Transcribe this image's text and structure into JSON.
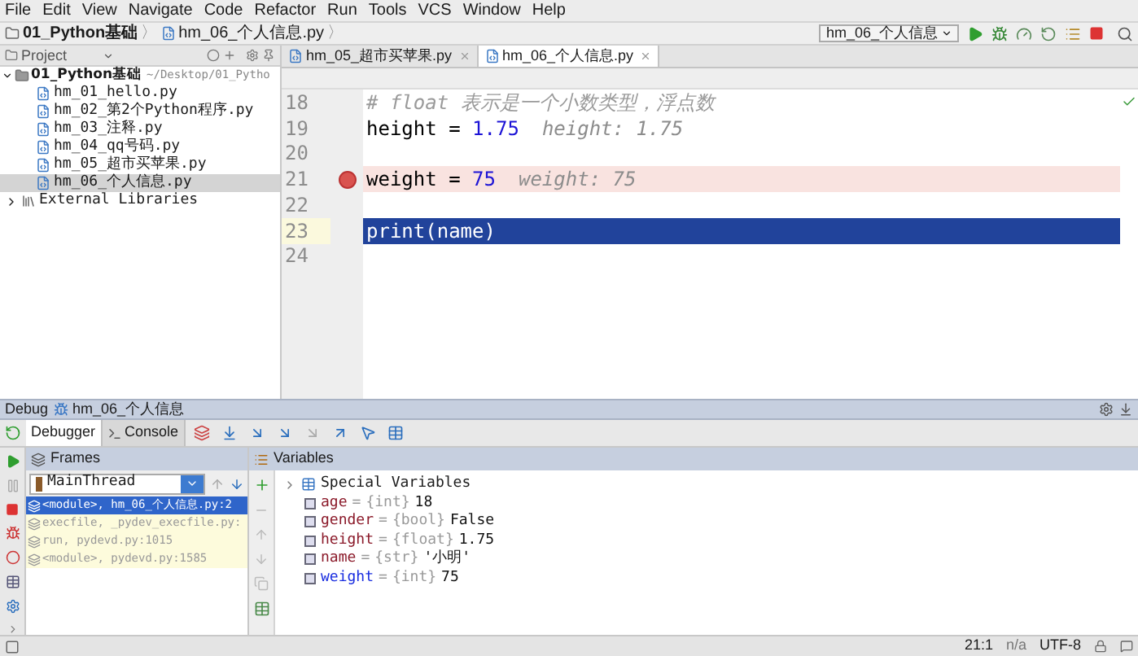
{
  "menu": [
    "File",
    "Edit",
    "View",
    "Navigate",
    "Code",
    "Refactor",
    "Run",
    "Tools",
    "VCS",
    "Window",
    "Help"
  ],
  "breadcrumb": {
    "project": "01_Python基础",
    "file": "hm_06_个人信息.py",
    "separator": "〉"
  },
  "run_config": "hm_06_个人信息",
  "project_panel": {
    "title": "Project",
    "root": {
      "label": "01_Python基础",
      "path": "~/Desktop/01_Pytho",
      "expanded": true,
      "children": [
        {
          "label": "hm_01_hello.py",
          "selected": false
        },
        {
          "label": "hm_02_第2个Python程序.py",
          "selected": false
        },
        {
          "label": "hm_03_注释.py",
          "selected": false
        },
        {
          "label": "hm_04_qq号码.py",
          "selected": false
        },
        {
          "label": "hm_05_超市买苹果.py",
          "selected": false
        },
        {
          "label": "hm_06_个人信息.py",
          "selected": true
        }
      ]
    },
    "libraries": {
      "label": "External Libraries",
      "expanded": false
    }
  },
  "editor_tabs": [
    {
      "label": "hm_05_超市买苹果.py",
      "selected": false
    },
    {
      "label": "hm_06_个人信息.py",
      "selected": true
    }
  ],
  "code_lines": [
    {
      "number": "18",
      "breakpoint": false,
      "current": false,
      "segments": [
        {
          "kind": "comment",
          "text": "# float 表示是一个小数类型，浮点数"
        }
      ]
    },
    {
      "number": "19",
      "breakpoint": false,
      "current": false,
      "segments": [
        {
          "kind": "plain",
          "text": "height = "
        },
        {
          "kind": "number",
          "text": "1.75"
        },
        {
          "kind": "hint",
          "text": "height: 1.75"
        }
      ]
    },
    {
      "number": "20",
      "breakpoint": false,
      "current": false
    },
    {
      "number": "21",
      "breakpoint": true,
      "current": false,
      "segments": [
        {
          "kind": "plain",
          "text": "weight = "
        },
        {
          "kind": "number",
          "text": "75"
        },
        {
          "kind": "hint",
          "text": "weight: 75"
        }
      ]
    },
    {
      "number": "22",
      "breakpoint": false,
      "current": false
    },
    {
      "number": "23",
      "breakpoint": false,
      "current": true,
      "segments": [
        {
          "kind": "plain",
          "text": "print(name)"
        }
      ]
    },
    {
      "number": "24",
      "breakpoint": false,
      "current": false
    }
  ],
  "debug": {
    "title": "Debug",
    "config": "hm_06_个人信息",
    "tabs": [
      {
        "label": "Debugger",
        "selected": true
      },
      {
        "label": "Console",
        "selected": false
      }
    ],
    "frames": {
      "title": "Frames",
      "thread": "MainThread",
      "items": [
        {
          "label": "<module>, hm_06_个人信息.py:2",
          "selected": true,
          "library": false
        },
        {
          "label": "execfile, _pydev_execfile.py:",
          "selected": false,
          "library": true
        },
        {
          "label": "run, pydevd.py:1015",
          "selected": false,
          "library": true
        },
        {
          "label": "<module>, pydevd.py:1585",
          "selected": false,
          "library": true
        }
      ]
    },
    "variables": {
      "title": "Variables",
      "special": {
        "label": "Special Variables",
        "expanded": false
      },
      "items": [
        {
          "name": "age",
          "sign": "=",
          "type": "{int}",
          "value": "18",
          "changed": false
        },
        {
          "name": "gender",
          "sign": "=",
          "type": "{bool}",
          "value": "False",
          "changed": false
        },
        {
          "name": "height",
          "sign": "=",
          "type": "{float}",
          "value": "1.75",
          "changed": false
        },
        {
          "name": "name",
          "sign": "=",
          "type": "{str}",
          "value": "'小明'",
          "changed": false
        },
        {
          "name": "weight",
          "sign": "=",
          "type": "{int}",
          "value": "75",
          "changed": true
        }
      ]
    }
  },
  "status_bar": {
    "position": "21:1",
    "vcs": "n/a",
    "encoding": "UTF-8"
  }
}
